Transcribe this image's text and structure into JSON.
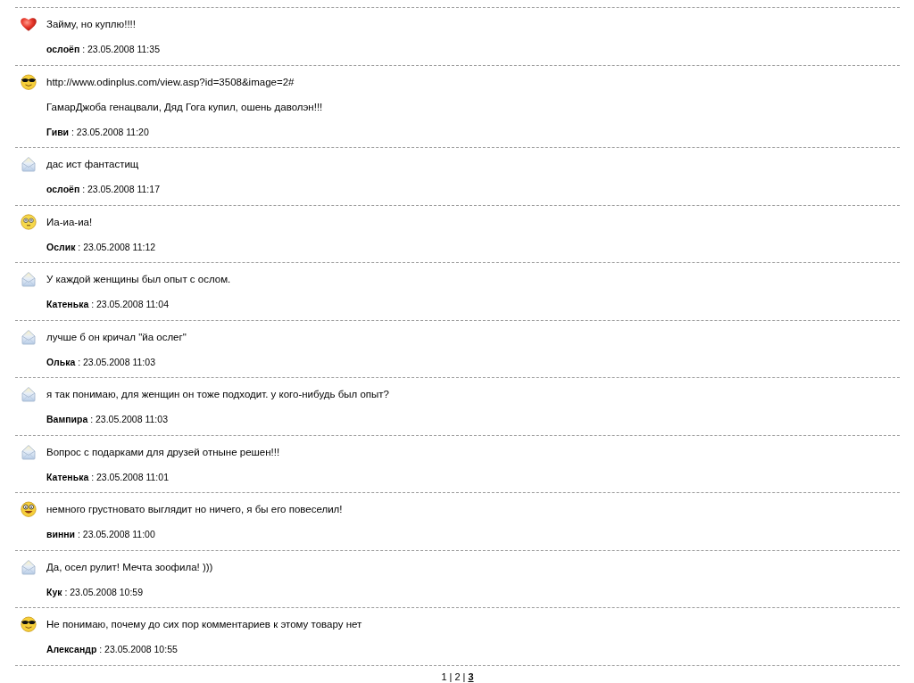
{
  "comments": [
    {
      "kind": "heart",
      "lines": [
        "Займу, но куплю!!!!"
      ],
      "byline": "**ослоёп** : 23.05.2008 11:35"
    },
    {
      "kind": "cool",
      "lines": [
        "http://www.odinplus.com/view.asp?id=3508&image=2#",
        "ГамарДжоба генацвали, Дяд Гога купил, ошень даволэн!!!"
      ],
      "byline": "**Гиви** : 23.05.2008 11:20"
    },
    {
      "kind": "envelope",
      "lines": [
        "дас ист фантастищ"
      ],
      "byline": "**ослоёп** : 23.05.2008 11:17"
    },
    {
      "kind": "surprised",
      "lines": [
        "Иа-иа-иа!"
      ],
      "byline": "**Ослик** : 23.05.2008 11:12"
    },
    {
      "kind": "envelope",
      "lines": [
        "У каждой женщины был опыт с ослом."
      ],
      "byline": "**Катенька** : 23.05.2008 11:04"
    },
    {
      "kind": "envelope",
      "lines": [
        "лучше б он кричал \"йа ослег\""
      ],
      "byline": "**Олька** : 23.05.2008 11:03"
    },
    {
      "kind": "envelope",
      "lines": [
        "я так понимаю, для женщин он тоже подходит. у кого-нибудь был опыт?"
      ],
      "byline": "**Вампира** : 23.05.2008 11:03"
    },
    {
      "kind": "envelope",
      "lines": [
        "Вопрос с подарками для друзей отныне решен!!!"
      ],
      "byline": "**Катенька** : 23.05.2008 11:01"
    },
    {
      "kind": "glasses",
      "lines": [
        "немного грустновато выглядит но ничего, я бы его повеселил!"
      ],
      "byline": "**винни** : 23.05.2008 11:00"
    },
    {
      "kind": "envelope",
      "lines": [
        "Да, осел рулит! Мечта зоофила! )))"
      ],
      "byline": "**Кук** : 23.05.2008 10:59"
    },
    {
      "kind": "cool",
      "lines": [
        "Не понимаю, почему до сих пор комментариев к этому товару нет"
      ],
      "byline": "**Александр** : 23.05.2008 10:55"
    }
  ],
  "pagination": {
    "separator": "|",
    "pages": [
      {
        "label": "1",
        "selected": false
      },
      {
        "label": "2",
        "selected": false
      },
      {
        "label": "3",
        "selected": true
      }
    ]
  }
}
